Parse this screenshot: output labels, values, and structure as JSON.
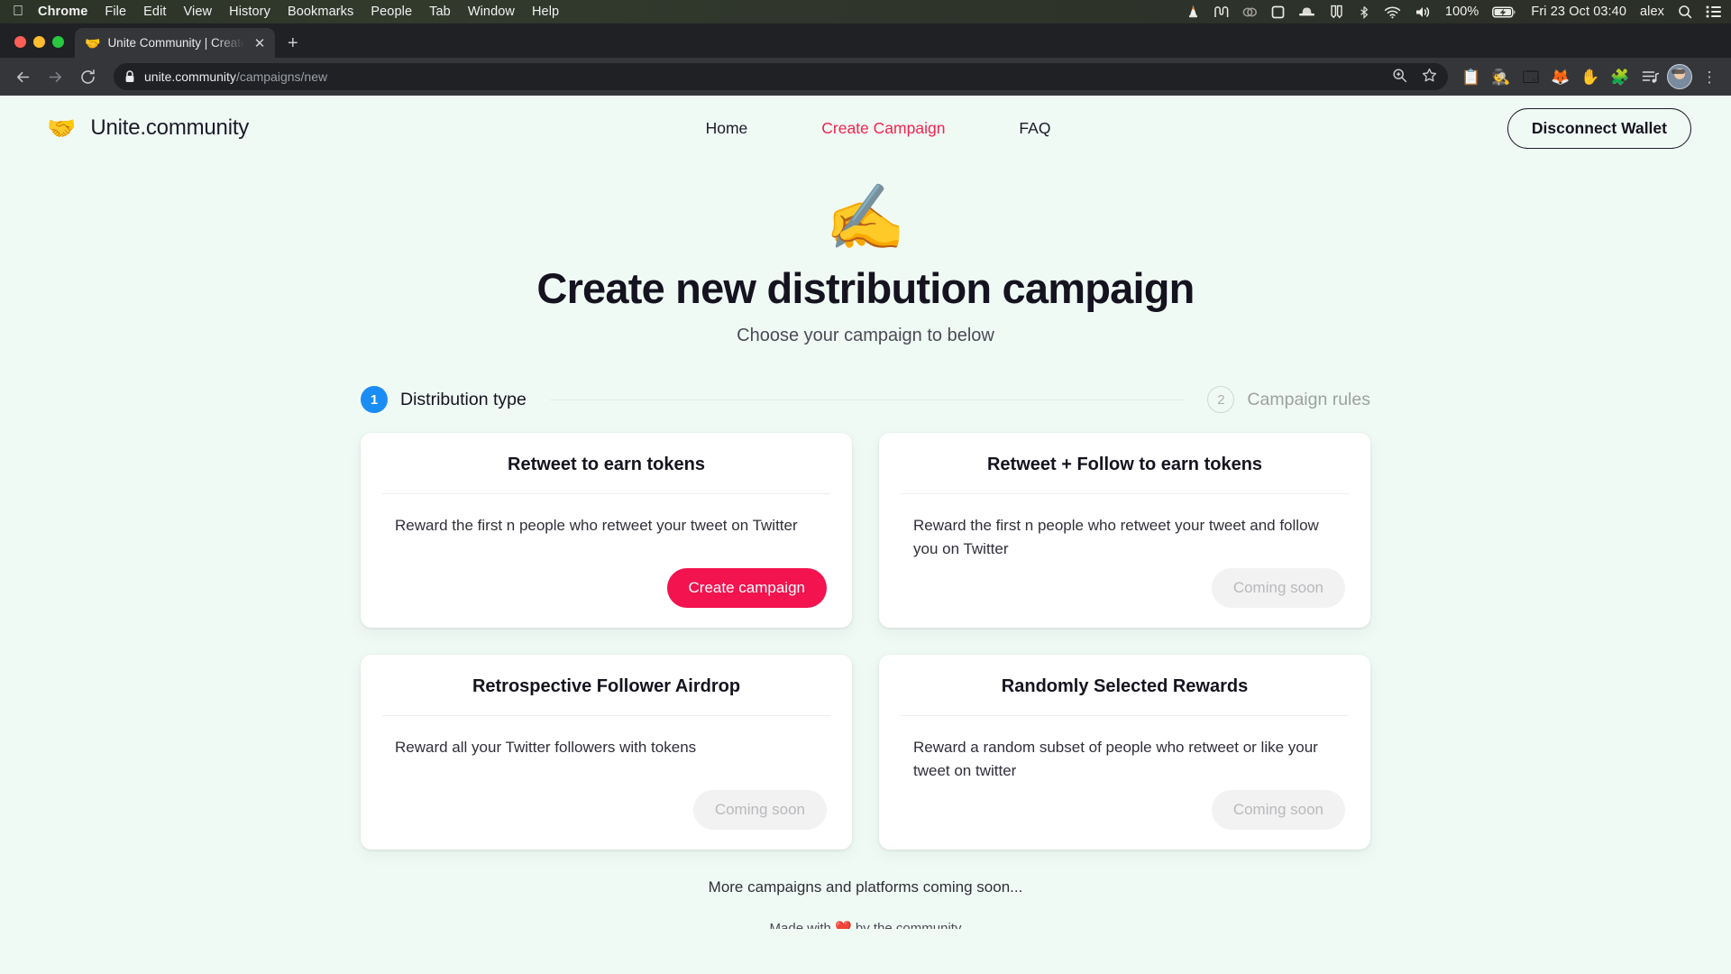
{
  "menubar": {
    "apple_icon": "apple-icon",
    "items": [
      {
        "label": "Chrome",
        "bold": true
      },
      {
        "label": "File",
        "bold": false
      },
      {
        "label": "Edit",
        "bold": false
      },
      {
        "label": "View",
        "bold": false
      },
      {
        "label": "History",
        "bold": false
      },
      {
        "label": "Bookmarks",
        "bold": false
      },
      {
        "label": "People",
        "bold": false
      },
      {
        "label": "Tab",
        "bold": false
      },
      {
        "label": "Window",
        "bold": false
      },
      {
        "label": "Help",
        "bold": false
      }
    ],
    "status_icons": [
      "vlc-cone-icon",
      "shottr-icon",
      "creative-cloud-icon",
      "square-icon",
      "incognito-hat-icon",
      "bitwarden-icon",
      "bluetooth-icon",
      "wifi-icon",
      "volume-icon"
    ],
    "battery_percent": "100%",
    "battery_icon": "battery-charging-icon",
    "datetime": "Fri 23 Oct  03:40",
    "user": "alex",
    "search_icon": "spotlight-search-icon",
    "control_center_icon": "control-center-icon"
  },
  "browser": {
    "window_controls": [
      "close-button",
      "minimize-button",
      "zoom-button"
    ],
    "tab": {
      "favicon": "🤝",
      "title": "Unite Community | Create Cam",
      "close_icon": "✕"
    },
    "new_tab_icon": "+",
    "back_icon": "←",
    "forward_icon": "→",
    "reload_icon": "⟳",
    "url_host": "unite.community",
    "url_path": "/campaigns/new",
    "lock_icon": "site-lock-icon",
    "omnibox_icons": [
      "zoom-search-icon",
      "bookmark-star-icon"
    ],
    "extensions": [
      "📋",
      "🕵",
      "🗔",
      "🦊",
      "✋",
      "🧩",
      "🎵"
    ],
    "profile_icon": "profile-avatar",
    "menu_icon": "⋮"
  },
  "site": {
    "brand": {
      "logo": "🤝",
      "name": "Unite.community"
    },
    "nav": [
      {
        "label": "Home",
        "active": false
      },
      {
        "label": "Create Campaign",
        "active": true
      },
      {
        "label": "FAQ",
        "active": false
      }
    ],
    "wallet_button": "Disconnect Wallet",
    "accent_color": "#f2134f",
    "background_color": "#f0faf5",
    "hero": {
      "emoji": "✍️",
      "title": "Create new distribution campaign",
      "subtitle": "Choose your campaign to below"
    },
    "stepper": {
      "steps": [
        {
          "number": "1",
          "label": "Distribution type",
          "active": true
        },
        {
          "number": "2",
          "label": "Campaign rules",
          "active": false
        }
      ]
    },
    "cards": [
      {
        "title": "Retweet to earn tokens",
        "description": "Reward the first n people who retweet your tweet on Twitter",
        "action_label": "Create campaign",
        "enabled": true
      },
      {
        "title": "Retweet + Follow to earn tokens",
        "description": "Reward the first n people who retweet your tweet and follow you on Twitter",
        "action_label": "Coming soon",
        "enabled": false
      },
      {
        "title": "Retrospective Follower Airdrop",
        "description": "Reward all your Twitter followers with tokens",
        "action_label": "Coming soon",
        "enabled": false
      },
      {
        "title": "Randomly Selected Rewards",
        "description": "Reward a random subset of people who retweet or like your tweet on twitter",
        "action_label": "Coming soon",
        "enabled": false
      }
    ],
    "footnote": "More campaigns and platforms coming soon...",
    "footer_partial": "Made with ❤️ by the community"
  }
}
